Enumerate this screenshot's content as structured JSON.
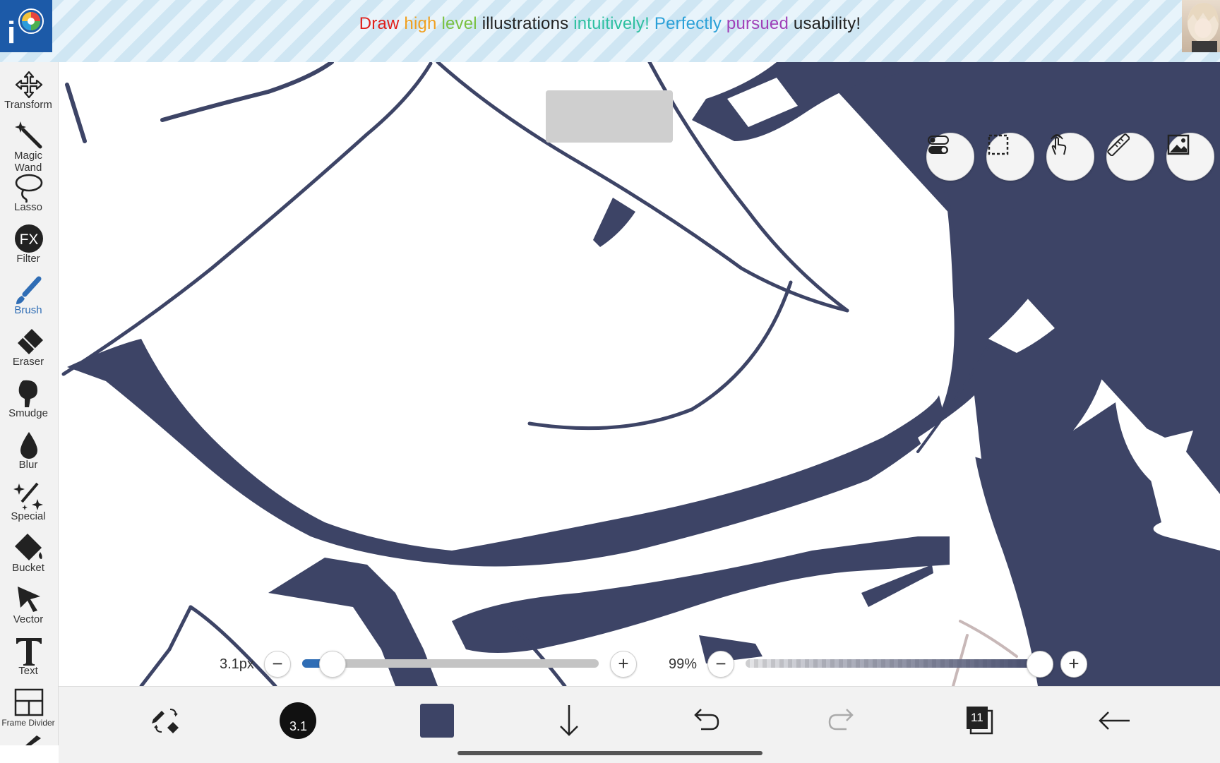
{
  "banner": {
    "logo_text": "i",
    "words": [
      {
        "text": "Draw ",
        "color": "#e0201b"
      },
      {
        "text": "high ",
        "color": "#f0a020"
      },
      {
        "text": "level ",
        "color": "#7ac142"
      },
      {
        "text": "illustrations ",
        "color": "#222222"
      },
      {
        "text": "intuitively! ",
        "color": "#2ec0a0"
      },
      {
        "text": "Perfectly ",
        "color": "#2aa0d8"
      },
      {
        "text": "pursued ",
        "color": "#a040b8"
      },
      {
        "text": "usability!",
        "color": "#222222"
      }
    ]
  },
  "toolbar": {
    "accent_color": "#2f6db5",
    "tools": [
      {
        "label": "Transform",
        "icon": "move-arrows-icon"
      },
      {
        "label": "Magic Wand",
        "icon": "magic-wand-icon"
      },
      {
        "label": "Lasso",
        "icon": "lasso-icon"
      },
      {
        "label": "Filter",
        "icon": "fx-icon"
      },
      {
        "label": "Brush",
        "icon": "brush-icon",
        "active": true
      },
      {
        "label": "Eraser",
        "icon": "eraser-icon"
      },
      {
        "label": "Smudge",
        "icon": "smudge-icon"
      },
      {
        "label": "Blur",
        "icon": "drop-icon"
      },
      {
        "label": "Special",
        "icon": "sparkle-pen-icon"
      },
      {
        "label": "Bucket",
        "icon": "bucket-icon"
      },
      {
        "label": "Vector",
        "icon": "cursor-arrow-icon"
      },
      {
        "label": "Text",
        "icon": "text-t-icon"
      },
      {
        "label": "Frame Divider",
        "icon": "frame-divider-icon"
      }
    ]
  },
  "canvas": {
    "ink_color": "#3d4466"
  },
  "quick_buttons": [
    {
      "name": "toggle-settings-button",
      "icon": "toggle-icon"
    },
    {
      "name": "selection-button",
      "icon": "dashed-selection-icon"
    },
    {
      "name": "touch-button",
      "icon": "touch-hand-icon"
    },
    {
      "name": "ruler-button",
      "icon": "ruler-icon"
    },
    {
      "name": "material-button",
      "icon": "image-icon"
    }
  ],
  "brush_size": {
    "label": "3.1px",
    "minus": "−",
    "plus": "+",
    "fraction": 0.1
  },
  "opacity": {
    "label": "99%",
    "minus": "−",
    "plus": "+",
    "fraction": 0.99
  },
  "bottom_bar": {
    "brush_badge": "3.1",
    "color_swatch": "#3d4466",
    "layer_count": "11",
    "icons": [
      "swap-pen-eraser-icon",
      "brush-size-dot-icon",
      "color-swatch-icon",
      "download-arrow-icon",
      "undo-icon",
      "redo-icon",
      "layers-icon",
      "back-arrow-icon"
    ]
  }
}
